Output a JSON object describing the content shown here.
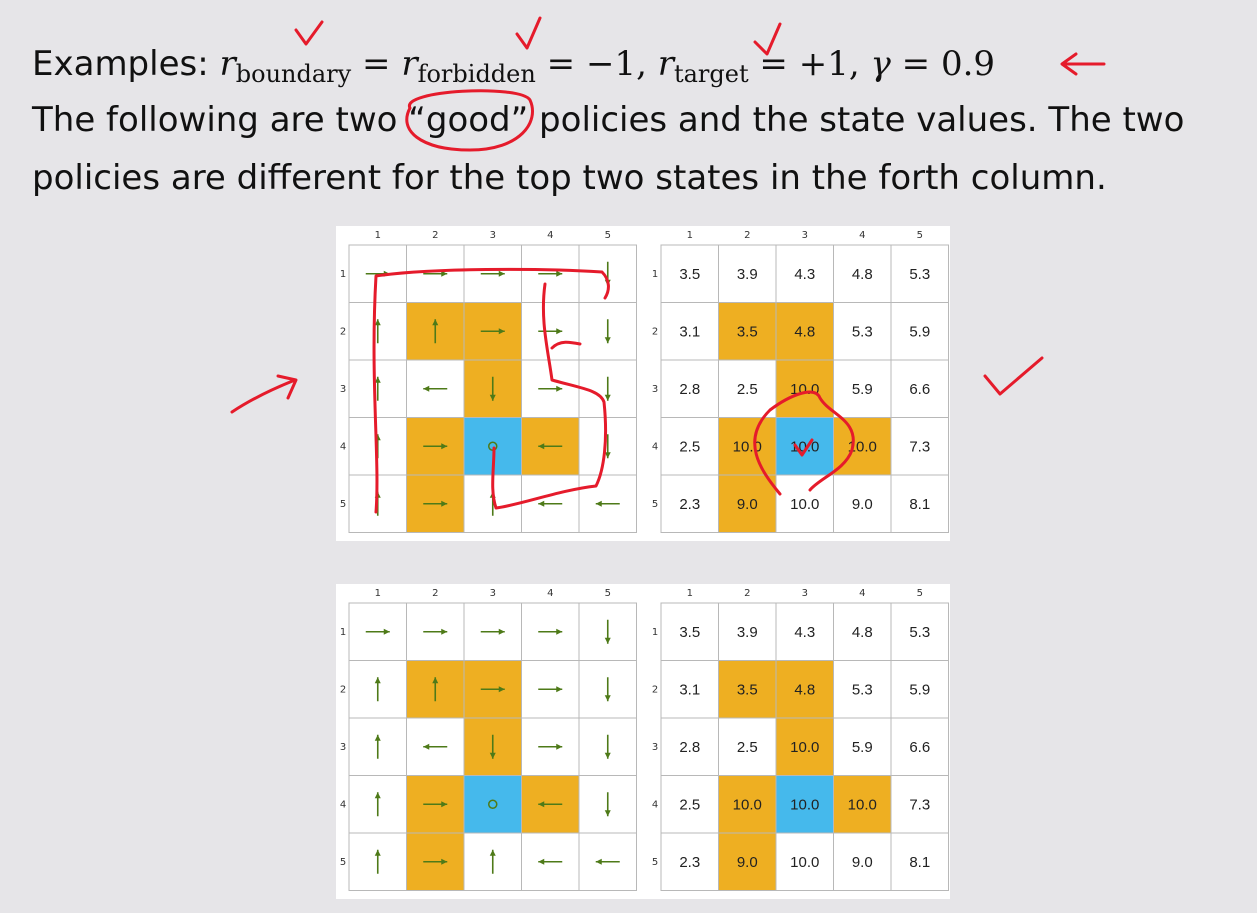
{
  "text": {
    "line1_prefix": "Examples:",
    "r": "r",
    "sub_boundary": "boundary",
    "sub_forbidden": "forbidden",
    "sub_target": "target",
    "eq": "=",
    "minus_one": "−1,",
    "plus_one": "+1,",
    "gamma": "γ",
    "gamma_val": "0.9",
    "line2_a": "The following are two ",
    "line2_good": "“good”",
    "line2_b": " policies and the state values.  The two",
    "line3": "policies are different for the top two states in the forth column."
  },
  "colors": {
    "forbidden": "#eeaf22",
    "target": "#45b9ec",
    "arrow": "#4e7a18",
    "annotation": "#e51b2b",
    "background": "#e6e5e8"
  },
  "grid": {
    "col_labels": [
      "1",
      "2",
      "3",
      "4",
      "5"
    ],
    "row_labels": [
      "1",
      "2",
      "3",
      "4",
      "5"
    ],
    "cells": [
      [
        "white",
        "white",
        "white",
        "white",
        "white"
      ],
      [
        "white",
        "forbidden",
        "forbidden",
        "white",
        "white"
      ],
      [
        "white",
        "white",
        "forbidden",
        "white",
        "white"
      ],
      [
        "white",
        "forbidden",
        "target",
        "forbidden",
        "white"
      ],
      [
        "white",
        "forbidden",
        "white",
        "white",
        "white"
      ]
    ]
  },
  "policies": [
    {
      "name": "policy-top",
      "actions": [
        [
          "right",
          "right",
          "right",
          "right",
          "down"
        ],
        [
          "up",
          "up",
          "right",
          "right",
          "down"
        ],
        [
          "up",
          "left",
          "down",
          "right",
          "down"
        ],
        [
          "up",
          "right",
          "stay",
          "left",
          "down"
        ],
        [
          "up",
          "right",
          "up",
          "left",
          "left"
        ]
      ],
      "values": [
        [
          "3.5",
          "3.9",
          "4.3",
          "4.8",
          "5.3"
        ],
        [
          "3.1",
          "3.5",
          "4.8",
          "5.3",
          "5.9"
        ],
        [
          "2.8",
          "2.5",
          "10.0",
          "5.9",
          "6.6"
        ],
        [
          "2.5",
          "10.0",
          "10.0",
          "10.0",
          "7.3"
        ],
        [
          "2.3",
          "9.0",
          "10.0",
          "9.0",
          "8.1"
        ]
      ]
    },
    {
      "name": "policy-bottom",
      "actions": [
        [
          "right",
          "right",
          "right",
          "right",
          "down"
        ],
        [
          "up",
          "up",
          "right",
          "right",
          "down"
        ],
        [
          "up",
          "left",
          "down",
          "right",
          "down"
        ],
        [
          "up",
          "right",
          "stay",
          "left",
          "down"
        ],
        [
          "up",
          "right",
          "up",
          "left",
          "left"
        ]
      ],
      "values": [
        [
          "3.5",
          "3.9",
          "4.3",
          "4.8",
          "5.3"
        ],
        [
          "3.1",
          "3.5",
          "4.8",
          "5.3",
          "5.9"
        ],
        [
          "2.8",
          "2.5",
          "10.0",
          "5.9",
          "6.6"
        ],
        [
          "2.5",
          "10.0",
          "10.0",
          "10.0",
          "7.3"
        ],
        [
          "2.3",
          "9.0",
          "10.0",
          "9.0",
          "8.1"
        ]
      ]
    }
  ]
}
